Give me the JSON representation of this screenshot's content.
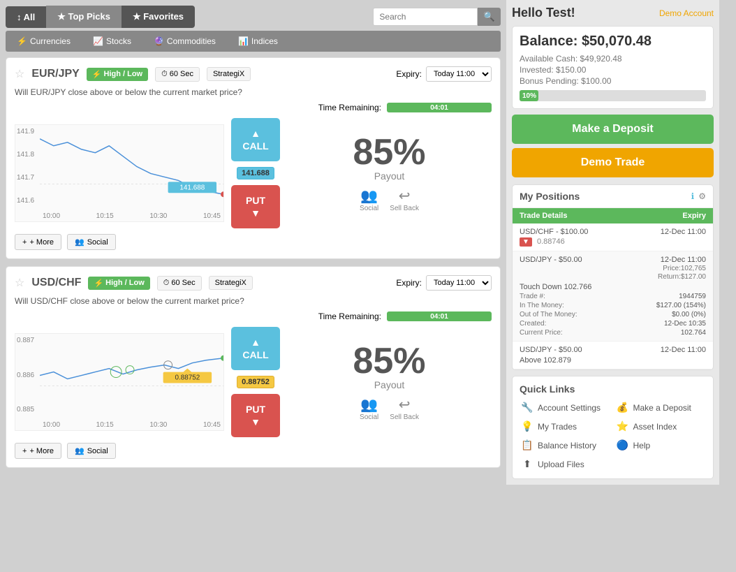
{
  "nav": {
    "all_label": "↕ All",
    "top_picks_label": "★ Top Picks",
    "favorites_label": "★ Favorites",
    "search_placeholder": "Search"
  },
  "sub_nav": {
    "items": [
      {
        "label": "Currencies",
        "icon": "⚡"
      },
      {
        "label": "Stocks",
        "icon": "📈"
      },
      {
        "label": "Commodities",
        "icon": "🔮"
      },
      {
        "label": "Indices",
        "icon": "📊"
      }
    ]
  },
  "trade_cards": [
    {
      "pair": "EUR/JPY",
      "badge": "High / Low",
      "time": "60 Sec",
      "platform": "StrategiX",
      "expiry": "Today 11:00",
      "question": "Will EUR/JPY close above or below the current market price?",
      "time_remaining_label": "Time Remaining:",
      "time_remaining": "04:01",
      "payout": "85%",
      "payout_label": "Payout",
      "call_label": "CALL",
      "put_label": "PUT",
      "current_price": "141.688",
      "chart_y": [
        "141.9",
        "141.8",
        "141.7",
        "141.6"
      ],
      "chart_x": [
        "10:00",
        "10:15",
        "10:30",
        "10:45"
      ],
      "social_label": "Social",
      "sell_back_label": "Sell Back",
      "more_label": "+ More"
    },
    {
      "pair": "USD/CHF",
      "badge": "High / Low",
      "time": "60 Sec",
      "platform": "StrategiX",
      "expiry": "Today 11:00",
      "question": "Will USD/CHF close above or below the current market price?",
      "time_remaining_label": "Time Remaining:",
      "time_remaining": "04:01",
      "payout": "85%",
      "payout_label": "Payout",
      "call_label": "CALL",
      "put_label": "PUT",
      "current_price": "0.88752",
      "chart_y": [
        "0.887",
        "0.886",
        "0.885"
      ],
      "chart_x": [
        "10:00",
        "10:15",
        "10:30",
        "10:45"
      ],
      "social_label": "Social",
      "sell_back_label": "Sell Back",
      "more_label": "+ More"
    }
  ],
  "right_panel": {
    "greeting": "Hello Test!",
    "demo_account": "Demo Account",
    "balance_label": "Balance:",
    "balance_amount": "$50,070.48",
    "available_cash_label": "Available Cash:",
    "available_cash": "$49,920.48",
    "invested_label": "Invested:",
    "invested": "$150.00",
    "bonus_label": "Bonus Pending:",
    "bonus": "$100.00",
    "bonus_percent": "10%",
    "deposit_btn": "Make a Deposit",
    "demo_trade_btn": "Demo Trade",
    "positions_title": "My Positions",
    "positions_col1": "Trade Details",
    "positions_col2": "Expiry",
    "positions": [
      {
        "pair": "USD/CHF - $100.00",
        "expiry": "12-Dec 11:00",
        "direction": "▼",
        "price": "0.88746",
        "details": []
      },
      {
        "pair": "USD/JPY - $50.00",
        "expiry": "12-Dec 11:00",
        "direction": null,
        "price": null,
        "touch_down": "Touch Down 102.766",
        "trade_num_label": "Trade #:",
        "trade_num": "1944759",
        "in_money_label": "In The Money:",
        "in_money": "$127.00 (154%)",
        "out_money_label": "Out of The Money:",
        "out_money": "$0.00 (0%)",
        "created_label": "Created:",
        "created": "12-Dec 10:35",
        "current_price_label": "Current Price:",
        "current_price": "102.764",
        "price_label": "Price:",
        "price_val": "102,765",
        "return_label": "Return:",
        "return_val": "$127.00"
      },
      {
        "pair": "USD/JPY - $50.00",
        "expiry": "12-Dec 11:00",
        "direction": null,
        "above": "Above 102.879"
      }
    ],
    "quick_links_title": "Quick Links",
    "quick_links": [
      {
        "label": "Account Settings",
        "icon": "🔧"
      },
      {
        "label": "Make a Deposit",
        "icon": "💰"
      },
      {
        "label": "My Trades",
        "icon": "💡"
      },
      {
        "label": "Asset Index",
        "icon": "⭐"
      },
      {
        "label": "Balance History",
        "icon": "📋"
      },
      {
        "label": "Help",
        "icon": "🔵"
      },
      {
        "label": "Upload Files",
        "icon": "⬆"
      }
    ]
  }
}
